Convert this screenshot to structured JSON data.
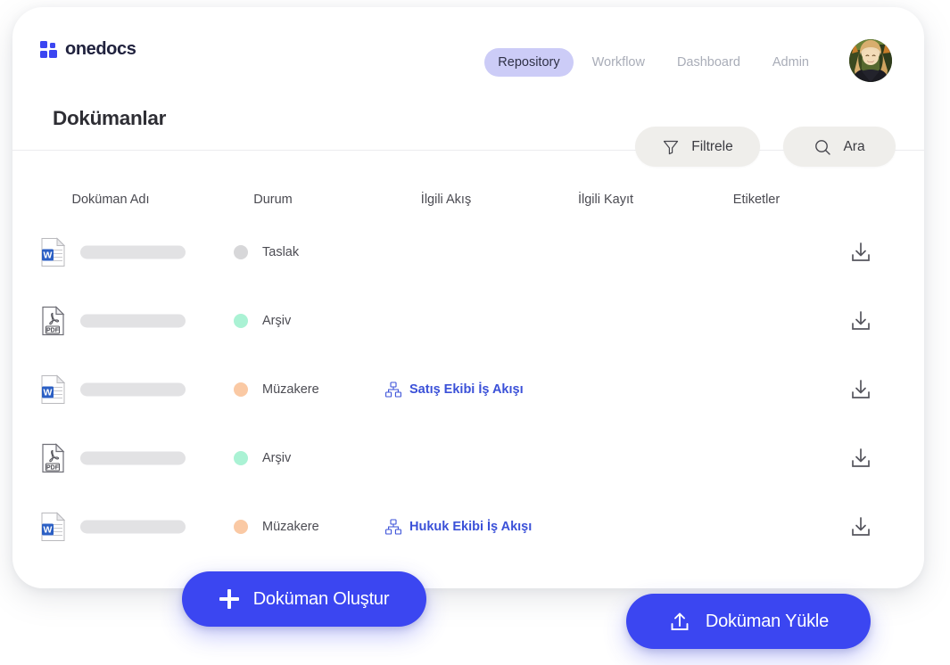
{
  "brand": {
    "name": "onedocs",
    "logo_icon": "four-squares-logo-icon",
    "color": "#3b46f1"
  },
  "nav": {
    "items": [
      {
        "label": "Repository",
        "active": true
      },
      {
        "label": "Workflow",
        "active": false
      },
      {
        "label": "Dashboard",
        "active": false
      },
      {
        "label": "Admin",
        "active": false
      }
    ],
    "active_pill_color": "#ccccf7",
    "avatar_icon": "user-avatar-photo"
  },
  "page": {
    "title": "Dokümanlar"
  },
  "actions": {
    "filter": {
      "label": "Filtrele",
      "icon": "funnel-icon"
    },
    "search": {
      "label": "Ara",
      "icon": "search-icon"
    }
  },
  "table": {
    "columns": [
      "Doküman Adı",
      "Durum",
      "İlgili Akış",
      "İlgili Kayıt",
      "Etiketler"
    ],
    "rows": [
      {
        "file_icon": "word-document-icon",
        "name": "",
        "status": {
          "label": "Taslak",
          "color": "#d7d7d9"
        },
        "flow": "",
        "flow_icon": "",
        "record": "",
        "tags": "",
        "download_icon": "download-icon"
      },
      {
        "file_icon": "pdf-document-icon",
        "name": "",
        "status": {
          "label": "Arşiv",
          "color": "#aaf2d4"
        },
        "flow": "",
        "flow_icon": "",
        "record": "",
        "tags": "",
        "download_icon": "download-icon"
      },
      {
        "file_icon": "word-document-icon",
        "name": "",
        "status": {
          "label": "Müzakere",
          "color": "#fac9a4"
        },
        "flow": "Satış Ekibi İş Akışı",
        "flow_icon": "workflow-hierarchy-icon",
        "record": "",
        "tags": "",
        "download_icon": "download-icon"
      },
      {
        "file_icon": "pdf-document-icon",
        "name": "",
        "status": {
          "label": "Arşiv",
          "color": "#aaf2d4"
        },
        "flow": "",
        "flow_icon": "",
        "record": "",
        "tags": "",
        "download_icon": "download-icon"
      },
      {
        "file_icon": "word-document-icon",
        "name": "",
        "status": {
          "label": "Müzakere",
          "color": "#fac9a4"
        },
        "flow": "Hukuk Ekibi İş Akışı",
        "flow_icon": "workflow-hierarchy-icon",
        "record": "",
        "tags": "",
        "download_icon": "download-icon"
      }
    ]
  },
  "cta": {
    "create": {
      "label": "Doküman Oluştur",
      "icon": "plus-icon",
      "color": "#3b46f1"
    },
    "upload": {
      "label": "Doküman Yükle",
      "icon": "upload-icon",
      "color": "#3b46f1"
    }
  }
}
